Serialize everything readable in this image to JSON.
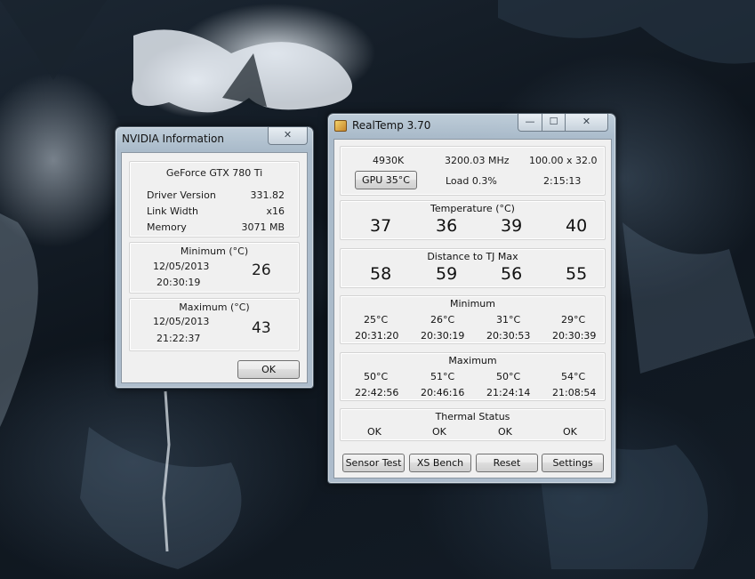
{
  "nvidia": {
    "title": "NVIDIA Information",
    "close_glyph": "✕",
    "gpu_name": "GeForce GTX 780 Ti",
    "rows": [
      {
        "label": "Driver Version",
        "value": "331.82"
      },
      {
        "label": "Link Width",
        "value": "x16"
      },
      {
        "label": "Memory",
        "value": "3071 MB"
      }
    ],
    "minimum": {
      "header": "Minimum (°C)",
      "date": "12/05/2013",
      "time": "20:30:19",
      "value": "26"
    },
    "maximum": {
      "header": "Maximum (°C)",
      "date": "12/05/2013",
      "time": "21:22:37",
      "value": "43"
    },
    "ok_label": "OK"
  },
  "realtemp": {
    "title": "RealTemp 3.70",
    "caption": {
      "min": "—",
      "max": "☐",
      "close": "✕"
    },
    "top": {
      "cpu_temp_k": "4930K",
      "mhz": "3200.03 MHz",
      "multiplier": "100.00 x 32.0",
      "gpu_button": "GPU  35°C",
      "load": "Load  0.3%",
      "uptime": "2:15:13"
    },
    "temperature": {
      "header": "Temperature (°C)",
      "values": [
        "37",
        "36",
        "39",
        "40"
      ]
    },
    "distance": {
      "header": "Distance to TJ Max",
      "values": [
        "58",
        "59",
        "56",
        "55"
      ]
    },
    "minimum": {
      "header": "Minimum",
      "temps": [
        "25°C",
        "26°C",
        "31°C",
        "29°C"
      ],
      "times": [
        "20:31:20",
        "20:30:19",
        "20:30:53",
        "20:30:39"
      ]
    },
    "maximum": {
      "header": "Maximum",
      "temps": [
        "50°C",
        "51°C",
        "50°C",
        "54°C"
      ],
      "times": [
        "22:42:56",
        "20:46:16",
        "21:24:14",
        "21:08:54"
      ]
    },
    "thermal": {
      "header": "Thermal Status",
      "values": [
        "OK",
        "OK",
        "OK",
        "OK"
      ]
    },
    "buttons": {
      "sensor_test": "Sensor Test",
      "xs_bench": "XS Bench",
      "reset": "Reset",
      "settings": "Settings"
    }
  }
}
